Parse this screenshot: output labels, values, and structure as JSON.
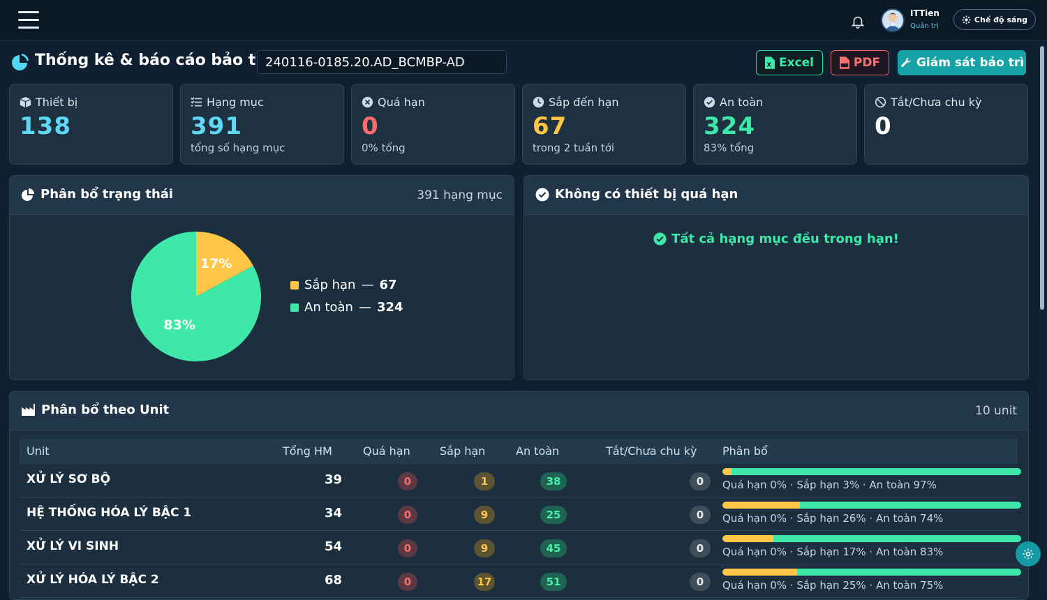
{
  "topbar": {
    "user_name": "ITTien",
    "user_role": "Quản trị",
    "theme_toggle_label": "Chế độ sáng"
  },
  "page": {
    "title": "Thống kê & báo cáo bảo trì",
    "report_code": "240116-0185.20.AD_BCMBP-AD",
    "excel_label": "Excel",
    "pdf_label": "PDF",
    "monitor_label": "Giám sát bảo trì"
  },
  "cards": [
    {
      "label": "Thiết bị",
      "value": "138",
      "sub": "",
      "icon": "box-icon",
      "color": "#5fd8f5"
    },
    {
      "label": "Hạng mục",
      "value": "391",
      "sub": "tổng số hạng mục",
      "icon": "list-icon",
      "color": "#5fd8f5"
    },
    {
      "label": "Quá hạn",
      "value": "0",
      "sub": "0% tổng",
      "icon": "x-circle-icon",
      "color": "#ff6a6a"
    },
    {
      "label": "Sắp đến hạn",
      "value": "67",
      "sub": "trong 2 tuần tới",
      "icon": "clock-icon",
      "color": "#ffc545"
    },
    {
      "label": "An toàn",
      "value": "324",
      "sub": "83% tổng",
      "icon": "check-circle-icon",
      "color": "#3de8a9"
    },
    {
      "label": "Tắt/Chưa chu kỳ",
      "value": "0",
      "sub": "",
      "icon": "ban-icon",
      "color": "#ffffff"
    }
  ],
  "status_panel": {
    "title": "Phân bổ trạng thái",
    "count": "391 hạng mục",
    "legend": [
      {
        "name": "Sắp hạn",
        "value": "67",
        "color": "#ffc545"
      },
      {
        "name": "An toàn",
        "value": "324",
        "color": "#3de8a9"
      }
    ]
  },
  "chart_data": {
    "type": "pie",
    "categories": [
      "Sắp hạn",
      "An toàn"
    ],
    "values": [
      67,
      324
    ],
    "labels": [
      "17%",
      "83%"
    ],
    "colors": [
      "#ffc545",
      "#3de8a9"
    ],
    "legend": "right"
  },
  "overdue_panel": {
    "title": "Không có thiết bị quá hạn",
    "message": "Tất cả hạng mục đều trong hạn!"
  },
  "unit_panel": {
    "title": "Phân bổ theo Unit",
    "count": "10 unit",
    "columns": [
      "Unit",
      "Tổng HM",
      "Quá hạn",
      "Sắp hạn",
      "An toàn",
      "Tắt/Chưa chu kỳ",
      "Phân bổ"
    ],
    "rows": [
      {
        "unit": "XỬ LÝ SƠ BỘ",
        "total": "39",
        "overdue": "0",
        "due": "1",
        "safe": "38",
        "off": "0",
        "overdue_pct": 0,
        "due_pct": 3,
        "safe_pct": 97,
        "dist": "Quá hạn 0% · Sắp hạn 3% · An toàn 97%"
      },
      {
        "unit": "HỆ THỐNG HÓA LÝ BẬC 1",
        "total": "34",
        "overdue": "0",
        "due": "9",
        "safe": "25",
        "off": "0",
        "overdue_pct": 0,
        "due_pct": 26,
        "safe_pct": 74,
        "dist": "Quá hạn 0% · Sắp hạn 26% · An toàn 74%"
      },
      {
        "unit": "XỬ LÝ VI SINH",
        "total": "54",
        "overdue": "0",
        "due": "9",
        "safe": "45",
        "off": "0",
        "overdue_pct": 0,
        "due_pct": 17,
        "safe_pct": 83,
        "dist": "Quá hạn 0% · Sắp hạn 17% · An toàn 83%"
      },
      {
        "unit": "XỬ LÝ HÓA LÝ BẬC 2",
        "total": "68",
        "overdue": "0",
        "due": "17",
        "safe": "51",
        "off": "0",
        "overdue_pct": 0,
        "due_pct": 25,
        "safe_pct": 75,
        "dist": "Quá hạn 0% · Sắp hạn 25% · An toàn 75%"
      }
    ]
  }
}
